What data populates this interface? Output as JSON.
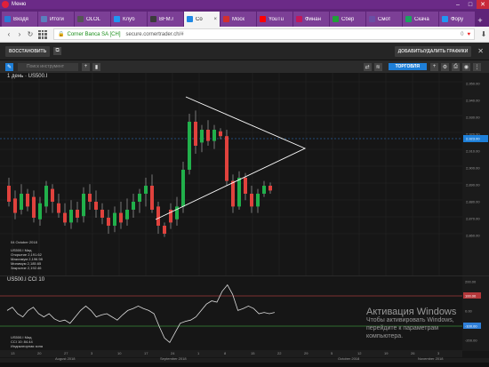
{
  "browser": {
    "menu_label": "Меню",
    "tabs": [
      {
        "label": "Входя",
        "color": "#2b79d4",
        "active": false
      },
      {
        "label": "Итоги",
        "color": "#5b7fbd",
        "active": false
      },
      {
        "label": "OLOL",
        "color": "#555555",
        "active": false
      },
      {
        "label": "Клуб",
        "color": "#2196f3",
        "active": false
      },
      {
        "label": "BFM.r",
        "color": "#3b3b3b",
        "active": false
      },
      {
        "label": "Co",
        "color": "#1e88e5",
        "active": true
      },
      {
        "label": "Моск",
        "color": "#d32f2f",
        "active": false
      },
      {
        "label": "YouTu",
        "color": "#ff0000",
        "active": false
      },
      {
        "label": "Финан",
        "color": "#c2185b",
        "active": false
      },
      {
        "label": "Сбер",
        "color": "#21a038",
        "active": false
      },
      {
        "label": "Смот",
        "color": "#6a4fa5",
        "active": false
      },
      {
        "label": "Скача",
        "color": "#1aa260",
        "active": false
      },
      {
        "label": "Фору",
        "color": "#2196f3",
        "active": false
      }
    ],
    "site_name": "Corner Banca SA [CH]",
    "url": "secure.cornertrader.ch/#",
    "vpn_label": "0"
  },
  "toolbar": {
    "restore_label": "ВОССТАНОВИТЬ",
    "add_chart_label": "ДОБАВИТЬ/УДАЛИТЬ ГРАФИКИ",
    "search_placeholder": "Поиск инструмент",
    "trade_label": "ТОРГОВЛЯ"
  },
  "chart": {
    "interval_label": "1 день",
    "instrument": "US500.I",
    "current_price_label": "2,923.00",
    "price_axis": [
      "2,950.00",
      "2,940.00",
      "2,930.00",
      "2,920.00",
      "2,910.00",
      "2,900.00",
      "2,890.00",
      "2,880.00",
      "2,870.00",
      "2,860.00"
    ],
    "info": {
      "date": "04 October 2018",
      "instrument": "US500.I Мид",
      "open_label": "Открытие",
      "open": "2,191.62",
      "high_label": "Максимум",
      "high": "2,196.98",
      "low_label": "Минимум",
      "low": "2,185.65",
      "close_label": "Закрытие",
      "close": "2,192.46"
    },
    "osc_title": "US500.I",
    "osc_indicator": "CCI 10",
    "osc_axis": [
      "200.00",
      "100.00",
      "0.00",
      "-100.00",
      "-200.00"
    ],
    "osc_info": {
      "instrument": "US500.I Мид",
      "indicator": "CCI 10: 84.44",
      "extra": "Индикаторная зона"
    },
    "x_days": [
      "13",
      "20",
      "27",
      "3",
      "10",
      "17",
      "24",
      "1",
      "8",
      "15",
      "22",
      "29",
      "5",
      "12",
      "19",
      "26",
      "3"
    ],
    "x_months": [
      "August 2018",
      "September 2018",
      "October 2018",
      "November 2018"
    ]
  },
  "windows_watermark": {
    "line1": "Активация Windows",
    "line2": "Чтобы активировать Windows,",
    "line3": "перейдите к параметрам",
    "line4": "компьютера."
  },
  "chart_data": {
    "type": "candlestick",
    "candles": [
      {
        "o": 0.35,
        "c": 0.25,
        "h": 0.4,
        "l": 0.22
      },
      {
        "o": 0.27,
        "c": 0.18,
        "h": 0.32,
        "l": 0.14
      },
      {
        "o": 0.2,
        "c": 0.3,
        "h": 0.36,
        "l": 0.17
      },
      {
        "o": 0.3,
        "c": 0.22,
        "h": 0.33,
        "l": 0.19
      },
      {
        "o": 0.28,
        "c": 0.15,
        "h": 0.32,
        "l": 0.12
      },
      {
        "o": 0.14,
        "c": 0.24,
        "h": 0.28,
        "l": 0.1
      },
      {
        "o": 0.22,
        "c": 0.35,
        "h": 0.38,
        "l": 0.18
      },
      {
        "o": 0.33,
        "c": 0.25,
        "h": 0.36,
        "l": 0.18
      },
      {
        "o": 0.24,
        "c": 0.18,
        "h": 0.3,
        "l": 0.15
      },
      {
        "o": 0.18,
        "c": 0.12,
        "h": 0.24,
        "l": 0.1
      },
      {
        "o": 0.12,
        "c": 0.2,
        "h": 0.26,
        "l": 0.08
      },
      {
        "o": 0.2,
        "c": 0.15,
        "h": 0.25,
        "l": 0.12
      },
      {
        "o": 0.16,
        "c": 0.3,
        "h": 0.34,
        "l": 0.12
      },
      {
        "o": 0.3,
        "c": 0.25,
        "h": 0.36,
        "l": 0.2
      },
      {
        "o": 0.25,
        "c": 0.2,
        "h": 0.32,
        "l": 0.15
      },
      {
        "o": 0.2,
        "c": 0.15,
        "h": 0.24,
        "l": 0.11
      },
      {
        "o": 0.15,
        "c": 0.1,
        "h": 0.2,
        "l": 0.05
      },
      {
        "o": 0.1,
        "c": 0.18,
        "h": 0.22,
        "l": 0.06
      },
      {
        "o": 0.18,
        "c": 0.12,
        "h": 0.25,
        "l": 0.08
      },
      {
        "o": 0.14,
        "c": 0.2,
        "h": 0.27,
        "l": 0.1
      },
      {
        "o": 0.2,
        "c": 0.25,
        "h": 0.3,
        "l": 0.15
      },
      {
        "o": 0.25,
        "c": 0.3,
        "h": 0.33,
        "l": 0.18
      },
      {
        "o": 0.3,
        "c": 0.35,
        "h": 0.4,
        "l": 0.22
      },
      {
        "o": 0.35,
        "c": 0.2,
        "h": 0.42,
        "l": 0.18
      },
      {
        "o": 0.22,
        "c": 0.1,
        "h": 0.25,
        "l": 0.05
      },
      {
        "o": 0.1,
        "c": 0.05,
        "h": 0.12,
        "l": 0.03
      },
      {
        "o": 0.2,
        "c": 0.12,
        "h": 0.24,
        "l": 0.08
      },
      {
        "o": 0.14,
        "c": 0.22,
        "h": 0.28,
        "l": 0.1
      },
      {
        "o": 0.22,
        "c": 0.45,
        "h": 0.5,
        "l": 0.18
      },
      {
        "o": 0.45,
        "c": 0.75,
        "h": 0.8,
        "l": 0.42
      },
      {
        "o": 0.75,
        "c": 0.6,
        "h": 0.82,
        "l": 0.55
      },
      {
        "o": 0.62,
        "c": 0.7,
        "h": 0.73,
        "l": 0.56
      },
      {
        "o": 0.7,
        "c": 0.63,
        "h": 0.76,
        "l": 0.6
      },
      {
        "o": 0.63,
        "c": 0.7,
        "h": 0.73,
        "l": 0.58
      },
      {
        "o": 0.69,
        "c": 0.66,
        "h": 0.71,
        "l": 0.64
      },
      {
        "o": 0.66,
        "c": 0.38,
        "h": 0.7,
        "l": 0.35
      },
      {
        "o": 0.38,
        "c": 0.22,
        "h": 0.42,
        "l": 0.18
      },
      {
        "o": 0.22,
        "c": 0.4,
        "h": 0.44,
        "l": 0.2
      },
      {
        "o": 0.4,
        "c": 0.3,
        "h": 0.43,
        "l": 0.26
      },
      {
        "o": 0.3,
        "c": 0.22,
        "h": 0.35,
        "l": 0.18
      },
      {
        "o": 0.22,
        "c": 0.3,
        "h": 0.33,
        "l": 0.18
      },
      {
        "o": 0.3,
        "c": 0.35,
        "h": 0.38,
        "l": 0.28
      },
      {
        "o": 0.35,
        "c": 0.32,
        "h": 0.37,
        "l": 0.3
      }
    ],
    "cci": [
      0.55,
      0.6,
      0.5,
      0.45,
      0.55,
      0.6,
      0.5,
      0.45,
      0.5,
      0.42,
      0.38,
      0.4,
      0.35,
      0.45,
      0.55,
      0.62,
      0.55,
      0.45,
      0.48,
      0.5,
      0.45,
      0.4,
      0.48,
      0.55,
      0.58,
      0.62,
      0.58,
      0.55,
      0.5,
      0.3,
      0.12,
      0.05,
      0.2,
      0.35,
      0.38,
      0.4,
      0.45,
      0.55,
      0.65,
      0.7,
      0.68,
      0.85,
      0.95,
      0.8,
      0.55,
      0.58,
      0.62,
      0.58,
      0.5,
      0.52,
      0.5,
      0.52
    ]
  }
}
